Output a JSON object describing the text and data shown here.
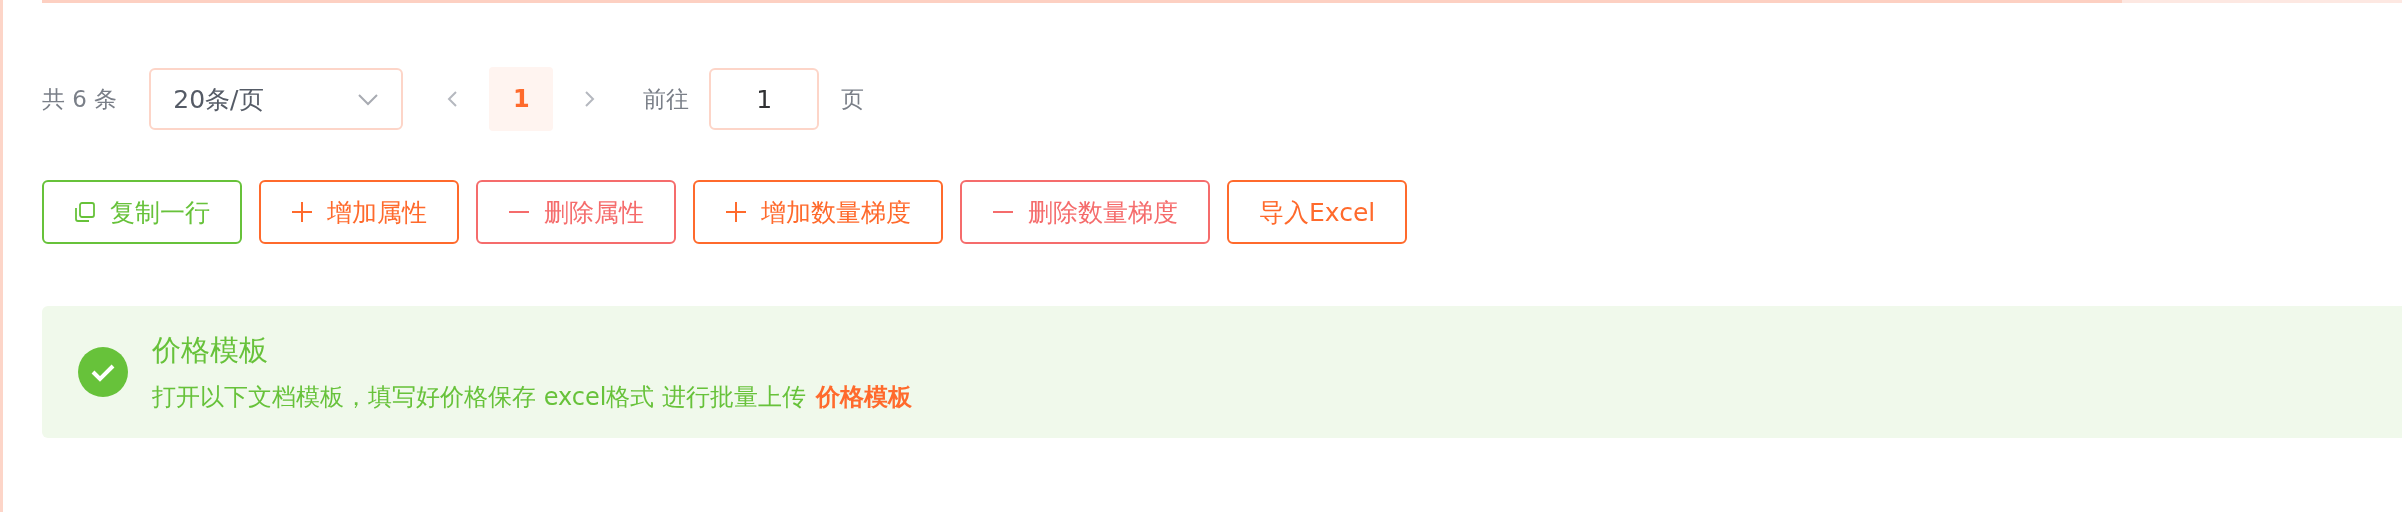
{
  "pagination": {
    "total": "共 6 条",
    "page_size": "20条/页",
    "pages": [
      {
        "label": "1",
        "selected": true
      }
    ],
    "goto_label": "前往",
    "goto_value": "1",
    "goto_suffix": "页"
  },
  "actions": [
    {
      "kind": "copy",
      "label": "复制一行"
    },
    {
      "kind": "add",
      "label": "增加属性"
    },
    {
      "kind": "remove",
      "label": "删除属性"
    },
    {
      "kind": "add",
      "label": "增加数量梯度"
    },
    {
      "kind": "remove",
      "label": "删除数量梯度"
    },
    {
      "kind": "import",
      "label": "导入Excel"
    }
  ],
  "alert": {
    "kind": "success",
    "title": "价格模板",
    "description": "打开以下文档模板，填写好价格保存 excel格式 进行批量上传",
    "link": "价格模板"
  }
}
